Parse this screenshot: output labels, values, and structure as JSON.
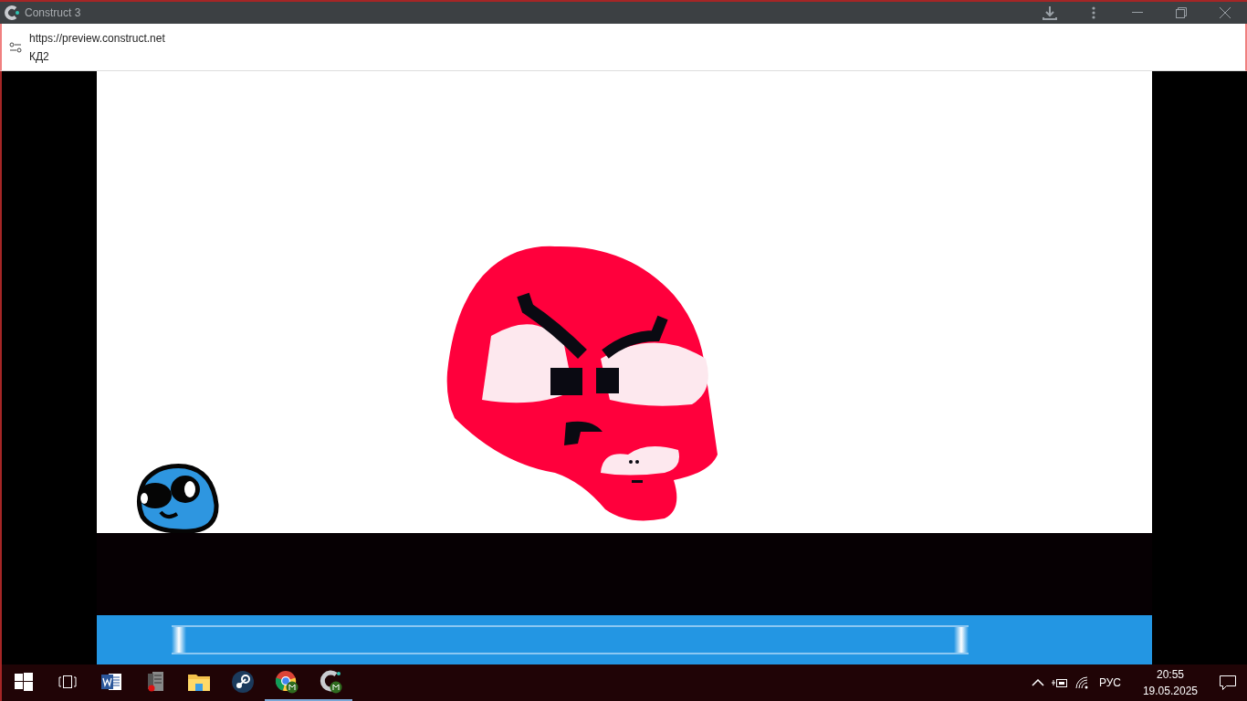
{
  "window": {
    "title": "Construct 3"
  },
  "address": {
    "url": "https://preview.construct.net",
    "page_title": "КД2"
  },
  "taskbar": {
    "apps": [
      {
        "kind": "start",
        "running": false
      },
      {
        "kind": "taskview",
        "running": false
      },
      {
        "kind": "word",
        "running": false
      },
      {
        "kind": "server",
        "running": false
      },
      {
        "kind": "explorer",
        "running": false
      },
      {
        "kind": "steam",
        "running": false
      },
      {
        "kind": "chrome",
        "running": true
      },
      {
        "kind": "construct",
        "running": true
      }
    ],
    "language": "РУС",
    "time": "20:55",
    "date": "19.05.2025"
  }
}
